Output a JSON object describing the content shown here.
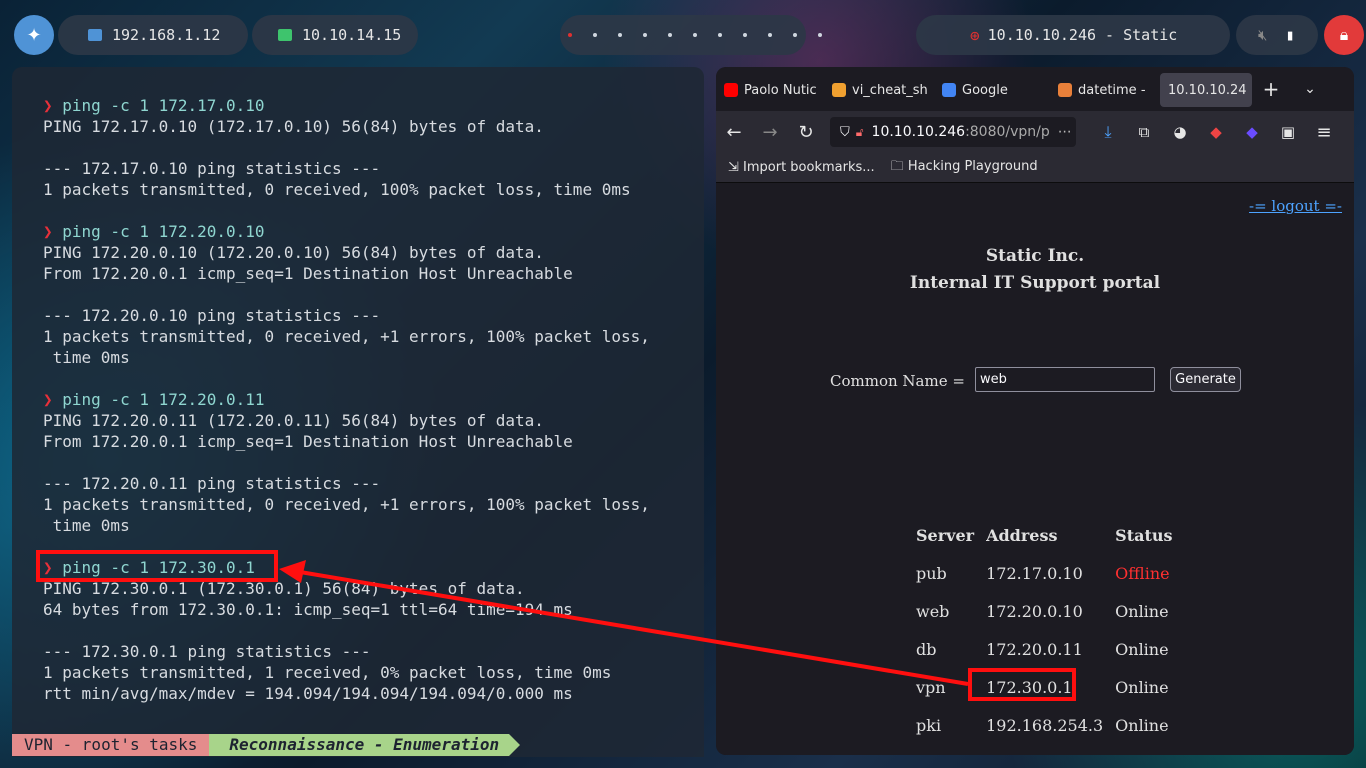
{
  "topbar": {
    "ip_home": "192.168.1.12",
    "ip_vpn": "10.10.14.15",
    "target": "10.10.10.246 - Static",
    "workspace_dots": 11
  },
  "terminal": {
    "lines": [
      {
        "type": "prompt",
        "text": "ping -c 1 172.17.0.10"
      },
      {
        "type": "out",
        "text": "PING 172.17.0.10 (172.17.0.10) 56(84) bytes of data."
      },
      {
        "type": "out",
        "text": ""
      },
      {
        "type": "out",
        "text": "--- 172.17.0.10 ping statistics ---"
      },
      {
        "type": "out",
        "text": "1 packets transmitted, 0 received, 100% packet loss, time 0ms"
      },
      {
        "type": "out",
        "text": ""
      },
      {
        "type": "prompt",
        "text": "ping -c 1 172.20.0.10"
      },
      {
        "type": "out",
        "text": "PING 172.20.0.10 (172.20.0.10) 56(84) bytes of data."
      },
      {
        "type": "out",
        "text": "From 172.20.0.1 icmp_seq=1 Destination Host Unreachable"
      },
      {
        "type": "out",
        "text": ""
      },
      {
        "type": "out",
        "text": "--- 172.20.0.10 ping statistics ---"
      },
      {
        "type": "out",
        "text": "1 packets transmitted, 0 received, +1 errors, 100% packet loss,"
      },
      {
        "type": "out",
        "text": " time 0ms"
      },
      {
        "type": "out",
        "text": ""
      },
      {
        "type": "prompt",
        "text": "ping -c 1 172.20.0.11"
      },
      {
        "type": "out",
        "text": "PING 172.20.0.11 (172.20.0.11) 56(84) bytes of data."
      },
      {
        "type": "out",
        "text": "From 172.20.0.1 icmp_seq=1 Destination Host Unreachable"
      },
      {
        "type": "out",
        "text": ""
      },
      {
        "type": "out",
        "text": "--- 172.20.0.11 ping statistics ---"
      },
      {
        "type": "out",
        "text": "1 packets transmitted, 0 received, +1 errors, 100% packet loss,"
      },
      {
        "type": "out",
        "text": " time 0ms"
      },
      {
        "type": "out",
        "text": ""
      },
      {
        "type": "prompt",
        "text": "ping -c 1 172.30.0.1"
      },
      {
        "type": "out",
        "text": "PING 172.30.0.1 (172.30.0.1) 56(84) bytes of data."
      },
      {
        "type": "out",
        "text": "64 bytes from 172.30.0.1: icmp_seq=1 ttl=64 time=194 ms"
      },
      {
        "type": "out",
        "text": ""
      },
      {
        "type": "out",
        "text": "--- 172.30.0.1 ping statistics ---"
      },
      {
        "type": "out",
        "text": "1 packets transmitted, 1 received, 0% packet loss, time 0ms"
      },
      {
        "type": "out",
        "text": "rtt min/avg/max/mdev = 194.094/194.094/194.094/0.000 ms"
      }
    ],
    "status_seg1": "VPN - root's tasks",
    "status_seg2": "Reconnaissance - Enumeration"
  },
  "browser": {
    "tabs": [
      {
        "label": "Paolo Nutic",
        "color": "#ff0000"
      },
      {
        "label": "vi_cheat_sh",
        "color": "#f0a030"
      },
      {
        "label": "Google",
        "color": "#4285f4"
      },
      {
        "label": "datetime -",
        "color": "#e8803a"
      },
      {
        "label": "10.10.10.24",
        "color": "#42414d"
      }
    ],
    "url_host": "10.10.10.246",
    "url_rest": ":8080/vpn/p",
    "bookmarks": [
      "Import bookmarks...",
      "Hacking Playground"
    ],
    "page": {
      "logout": "-= logout =-",
      "title1": "Static Inc.",
      "title2": "Internal IT Support portal",
      "cn_label": "Common Name =",
      "cn_value": "web",
      "generate": "Generate",
      "headers": [
        "Server",
        "Address",
        "Status"
      ],
      "rows": [
        {
          "server": "pub",
          "address": "172.17.0.10",
          "status": "Offline",
          "offline": true
        },
        {
          "server": "web",
          "address": "172.20.0.10",
          "status": "Online",
          "offline": false
        },
        {
          "server": "db",
          "address": "172.20.0.11",
          "status": "Online",
          "offline": false
        },
        {
          "server": "vpn",
          "address": "172.30.0.1",
          "status": "Online",
          "offline": false
        },
        {
          "server": "pki",
          "address": "192.168.254.3",
          "status": "Online",
          "offline": false
        }
      ]
    }
  },
  "colors": {
    "highlight": "#ff0f0f",
    "offline": "#ff3030",
    "prompt": "#e8303a"
  }
}
